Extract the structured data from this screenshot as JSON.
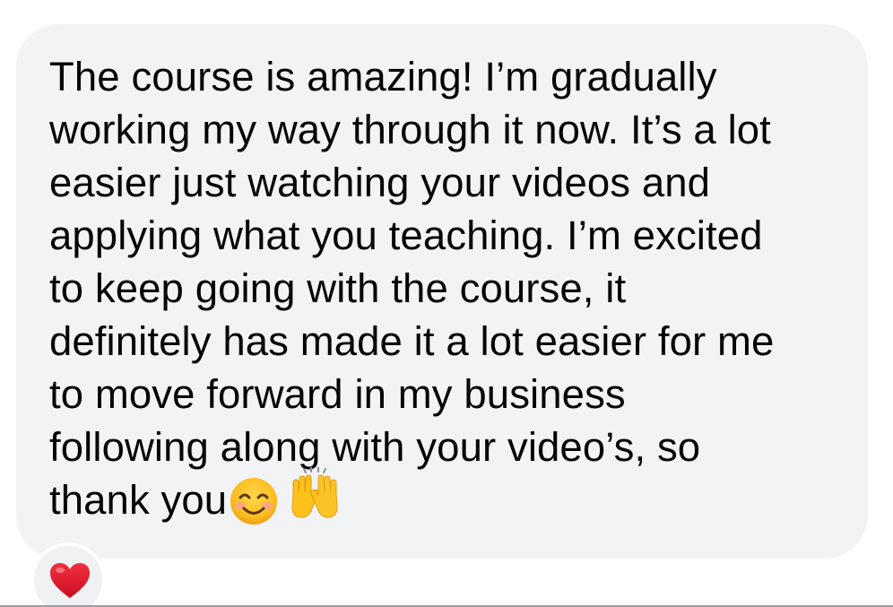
{
  "message": {
    "lines": [
      "The course is amazing! I’m gradually",
      "working my way through it now. It’s a lot",
      "easier just watching your videos and",
      "applying what you teaching. I’m excited",
      "to keep going with the course, it",
      "definitely has made it a lot easier for me",
      "to move forward in my business",
      "following along with your video’s, so",
      "thank you"
    ],
    "emojis": [
      "smiling-face-icon",
      "raising-hands-icon"
    ]
  },
  "reaction": {
    "icon": "red-heart-icon",
    "color": "#e0152c"
  },
  "colors": {
    "bubble": "#f2f3f5",
    "text": "#050505"
  }
}
